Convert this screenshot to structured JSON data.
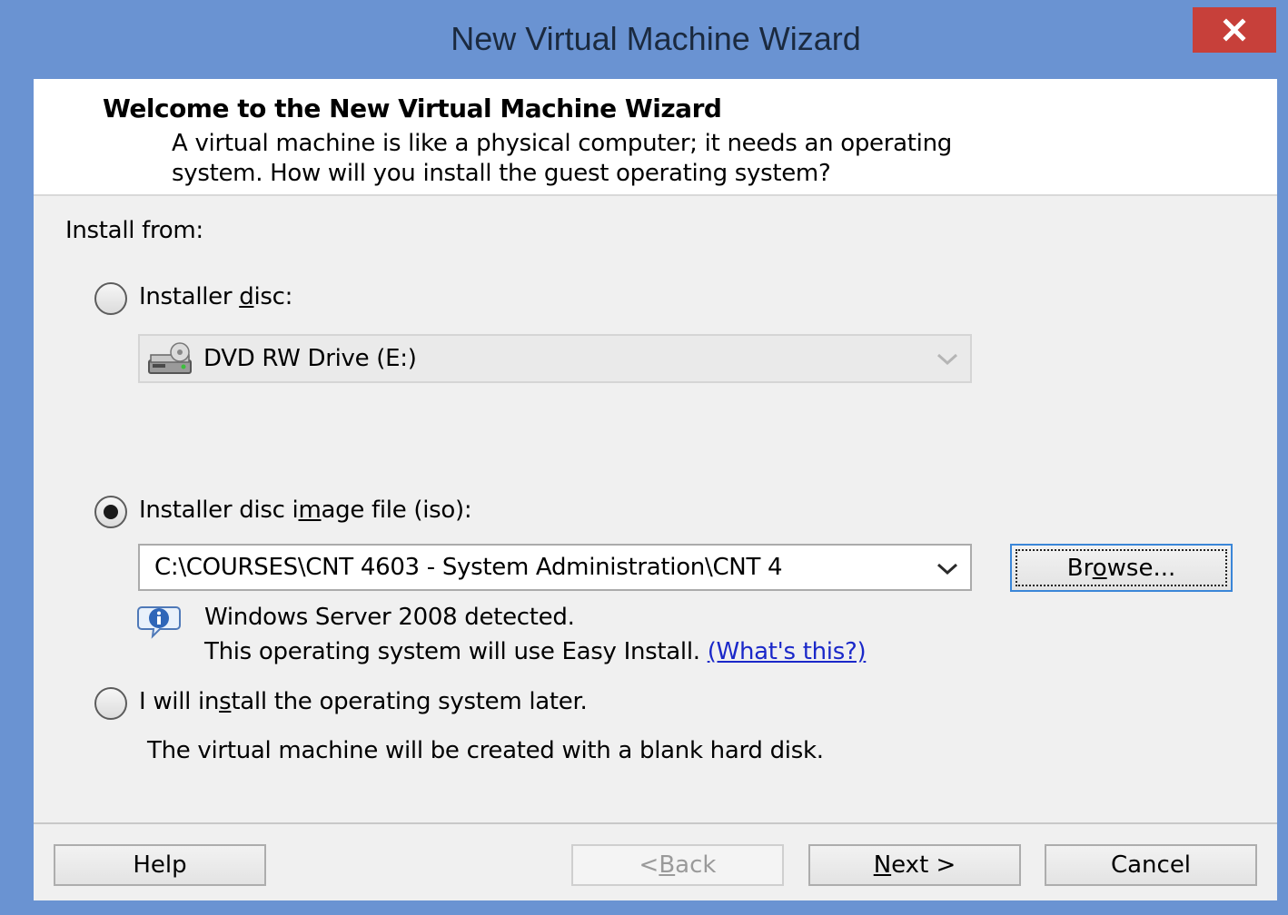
{
  "window": {
    "title": "New Virtual Machine Wizard",
    "close_label": "×"
  },
  "header": {
    "title": "Welcome to the New Virtual Machine Wizard",
    "description_line1": "A virtual machine is like a physical computer; it needs an operating",
    "description_line2": "system. How will you install the guest operating system?"
  },
  "install": {
    "section_label": "Install from:",
    "disc": {
      "label_pre": "Installer ",
      "label_accel": "d",
      "label_post": "isc:",
      "selected": false,
      "drive_value": "DVD RW Drive (E:)",
      "drive_icon": "dvd-drive-icon"
    },
    "iso": {
      "label_pre": "Installer disc i",
      "label_accel": "m",
      "label_post": "age file (iso):",
      "selected": true,
      "path_value": "C:\\COURSES\\CNT 4603 - System Administration\\CNT 4",
      "browse_pre": "Br",
      "browse_accel": "o",
      "browse_post": "wse...",
      "info_icon": "info-icon",
      "detected_line": "Windows Server 2008 detected.",
      "easy_install_line": "This operating system will use Easy Install.",
      "whats_this_link": "(What's this?)"
    },
    "later": {
      "label_pre": "I will in",
      "label_accel": "s",
      "label_post": "tall the operating system later.",
      "selected": false,
      "description": "The virtual machine will be created with a blank hard disk."
    }
  },
  "footer": {
    "help_label": "Help",
    "back_pre": "< ",
    "back_accel": "B",
    "back_post": "ack",
    "next_accel": "N",
    "next_post": "ext >",
    "cancel_label": "Cancel"
  },
  "colors": {
    "title_bar": "#6a93d2",
    "close_button": "#c7403a",
    "link": "#1a28c9"
  }
}
